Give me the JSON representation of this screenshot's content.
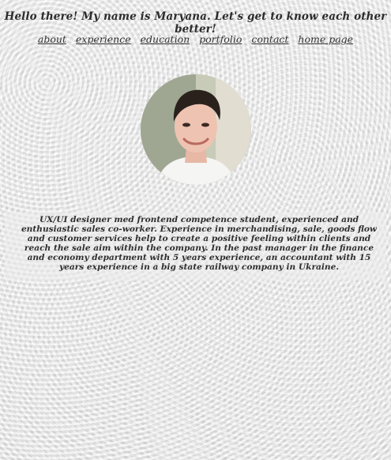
{
  "header": {
    "title": "Hello there! My name is Maryana. Let's get to know each other better!"
  },
  "nav": {
    "items": [
      {
        "label": "about"
      },
      {
        "label": "experience"
      },
      {
        "label": "education"
      },
      {
        "label": "portfolio"
      },
      {
        "label": "contact"
      },
      {
        "label": "home page"
      }
    ]
  },
  "profile": {
    "photo_icon": "profile-photo"
  },
  "about": {
    "text": "UX/UI designer med frontend competence student, experienced and enthusiastic sales co-worker. Experience in merchandising, sale, goods flow and customer services help to create a positive feeling within clients and reach the sale aim within the company. In the past manager in the finance and economy department with 5 years experience, an accountant with 15 years experience in a big state railway company in Ukraine."
  },
  "colors": {
    "text": "#2b2b2b",
    "background": "#e6e6e6"
  }
}
